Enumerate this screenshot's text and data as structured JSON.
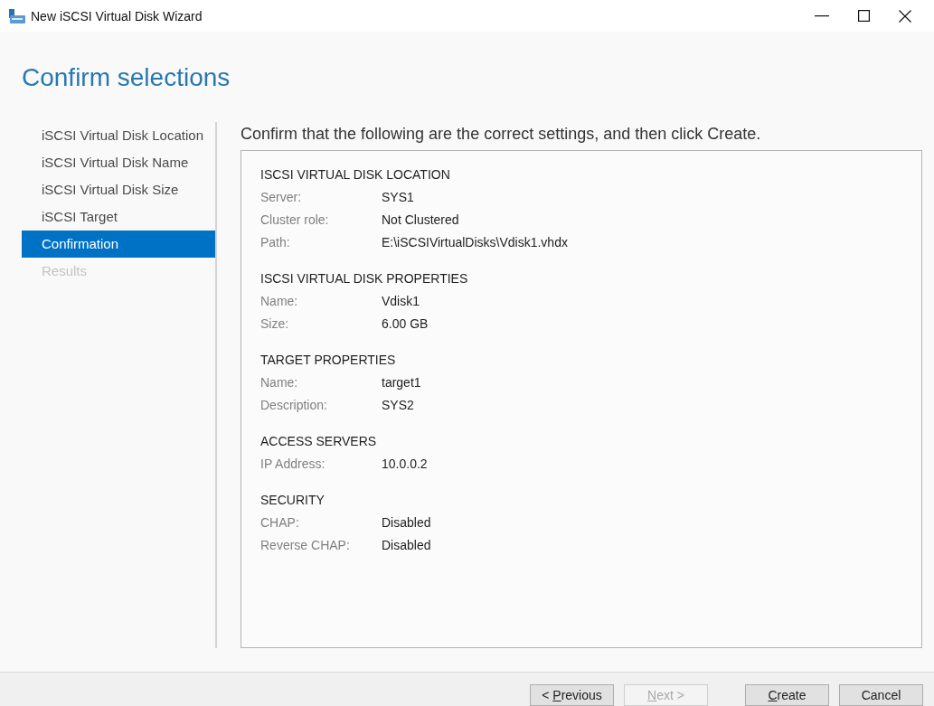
{
  "window": {
    "title": "New iSCSI Virtual Disk Wizard"
  },
  "page_title": "Confirm selections",
  "steps": [
    {
      "label": "iSCSI Virtual Disk Location",
      "selected": false,
      "disabled": false
    },
    {
      "label": "iSCSI Virtual Disk Name",
      "selected": false,
      "disabled": false
    },
    {
      "label": "iSCSI Virtual Disk Size",
      "selected": false,
      "disabled": false
    },
    {
      "label": "iSCSI Target",
      "selected": false,
      "disabled": false
    },
    {
      "label": "Confirmation",
      "selected": true,
      "disabled": false
    },
    {
      "label": "Results",
      "selected": false,
      "disabled": true
    }
  ],
  "instruction": "Confirm that the following are the correct settings, and then click Create.",
  "sections": [
    {
      "heading": "ISCSI VIRTUAL DISK LOCATION",
      "rows": [
        {
          "label": "Server:",
          "value": "SYS1"
        },
        {
          "label": "Cluster role:",
          "value": "Not Clustered"
        },
        {
          "label": "Path:",
          "value": "E:\\iSCSIVirtualDisks\\Vdisk1.vhdx"
        }
      ]
    },
    {
      "heading": "ISCSI VIRTUAL DISK PROPERTIES",
      "rows": [
        {
          "label": "Name:",
          "value": "Vdisk1"
        },
        {
          "label": "Size:",
          "value": "6.00 GB"
        }
      ]
    },
    {
      "heading": "TARGET PROPERTIES",
      "rows": [
        {
          "label": "Name:",
          "value": "target1"
        },
        {
          "label": "Description:",
          "value": "SYS2"
        }
      ]
    },
    {
      "heading": "ACCESS SERVERS",
      "rows": [
        {
          "label": "IP Address:",
          "value": "10.0.0.2"
        }
      ]
    },
    {
      "heading": "SECURITY",
      "rows": [
        {
          "label": "CHAP:",
          "value": "Disabled"
        },
        {
          "label": "Reverse CHAP:",
          "value": "Disabled"
        }
      ]
    }
  ],
  "nav_buttons": [
    {
      "before": "< ",
      "access_key": "P",
      "after": "revious",
      "disabled": false
    },
    {
      "access_key": "N",
      "after": "ext >",
      "disabled": true
    }
  ],
  "action_buttons": [
    {
      "access_key": "C",
      "after": "reate",
      "disabled": false
    },
    {
      "before": "Cancel",
      "disabled": false
    }
  ]
}
